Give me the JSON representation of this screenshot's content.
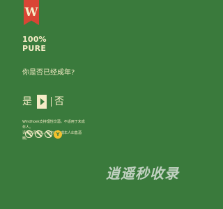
{
  "brand": {
    "logo_letter": "W",
    "tagline_percent": "100%",
    "tagline_word": "PURE"
  },
  "age_gate": {
    "question": "你是否已经成年?",
    "yes_label": "是",
    "no_label": "否"
  },
  "disclaimer": {
    "line1": "Windhoek支持理性饮酒。不适用于未成年人。",
    "line2": "请勿饮酒驾车。请勿向未成年人出售酒精。"
  },
  "warning_icons": [
    "no-drink-drive-icon",
    "no-pregnant-icon",
    "no-minor-icon"
  ],
  "warning_badge": "Y",
  "watermark": "逍遥秒收录",
  "colors": {
    "background": "#3a7a3c",
    "logo_red": "#d94535",
    "cream": "#f5ecc6",
    "yellow": "#f2c12e"
  }
}
